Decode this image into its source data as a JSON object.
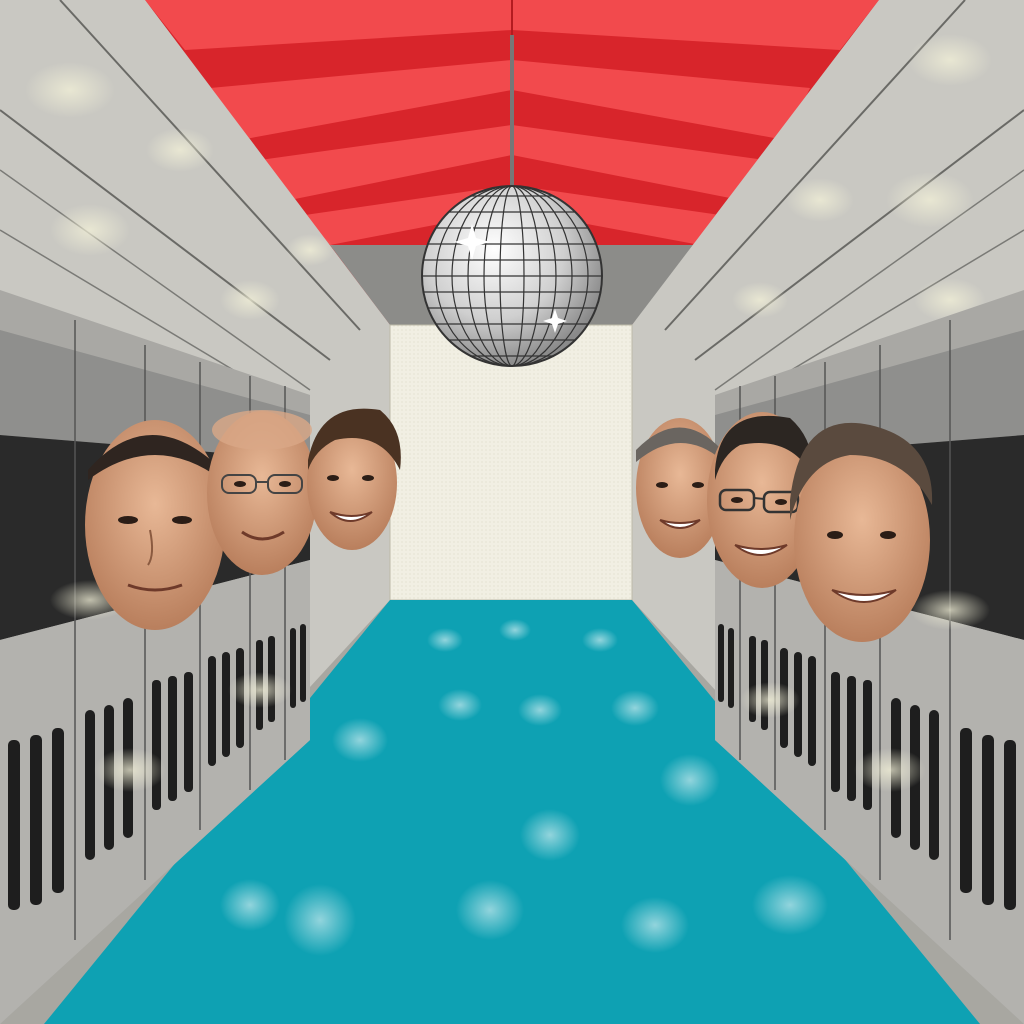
{
  "scene": {
    "description_text": "",
    "colors": {
      "ceiling_light": "#f24a4d",
      "ceiling_dark": "#d8252b",
      "wall_light": "#c9c8c2",
      "wall_dark": "#a8a7a1",
      "floor": "#0ea1b3",
      "back_wall": "#f1efe3",
      "rack_body": "#8f8f8d",
      "rack_dark": "#2a2a2a",
      "skin": "#d6a07e",
      "hair": "#3a2a20"
    },
    "icons": {
      "disco_ball": "disco-ball-icon",
      "server_rack": "server-rack-icon",
      "face": "face-icon"
    },
    "people_left_count": 3,
    "people_right_count": 3
  }
}
